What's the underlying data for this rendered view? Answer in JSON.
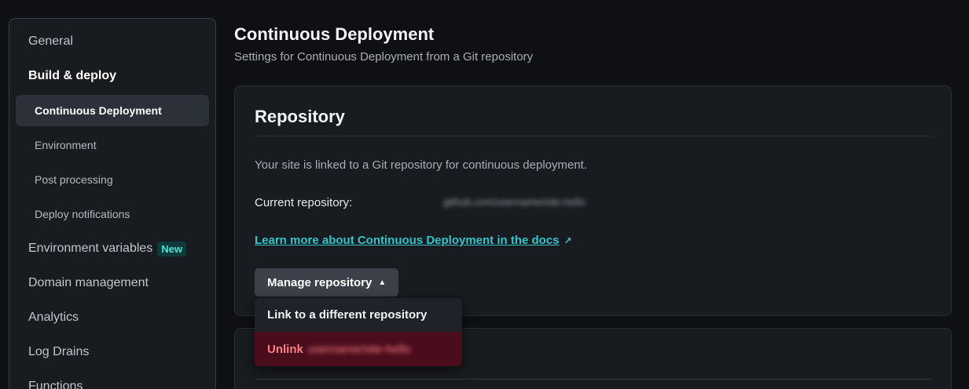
{
  "sidebar": {
    "items": [
      {
        "label": "General"
      },
      {
        "label": "Build & deploy"
      },
      {
        "label": "Continuous Deployment"
      },
      {
        "label": "Environment"
      },
      {
        "label": "Post processing"
      },
      {
        "label": "Deploy notifications"
      },
      {
        "label": "Environment variables",
        "badge": "New"
      },
      {
        "label": "Domain management"
      },
      {
        "label": "Analytics"
      },
      {
        "label": "Log Drains"
      },
      {
        "label": "Functions"
      }
    ]
  },
  "page": {
    "title": "Continuous Deployment",
    "subtitle": "Settings for Continuous Deployment from a Git repository"
  },
  "repository_card": {
    "title": "Repository",
    "description": "Your site is linked to a Git repository for continuous deployment.",
    "current_repo_label": "Current repository:",
    "current_repo_value": "github.com/username/site-hello",
    "docs_link": "Learn more about Continuous Deployment in the docs",
    "manage_button": "Manage repository"
  },
  "dropdown": {
    "link_different": "Link to a different repository",
    "unlink_label": "Unlink",
    "unlink_target": "username/site-hello"
  },
  "colors": {
    "accent": "#35c5c9",
    "danger_bg": "#4a0d1c",
    "danger_text": "#ff7f86"
  }
}
